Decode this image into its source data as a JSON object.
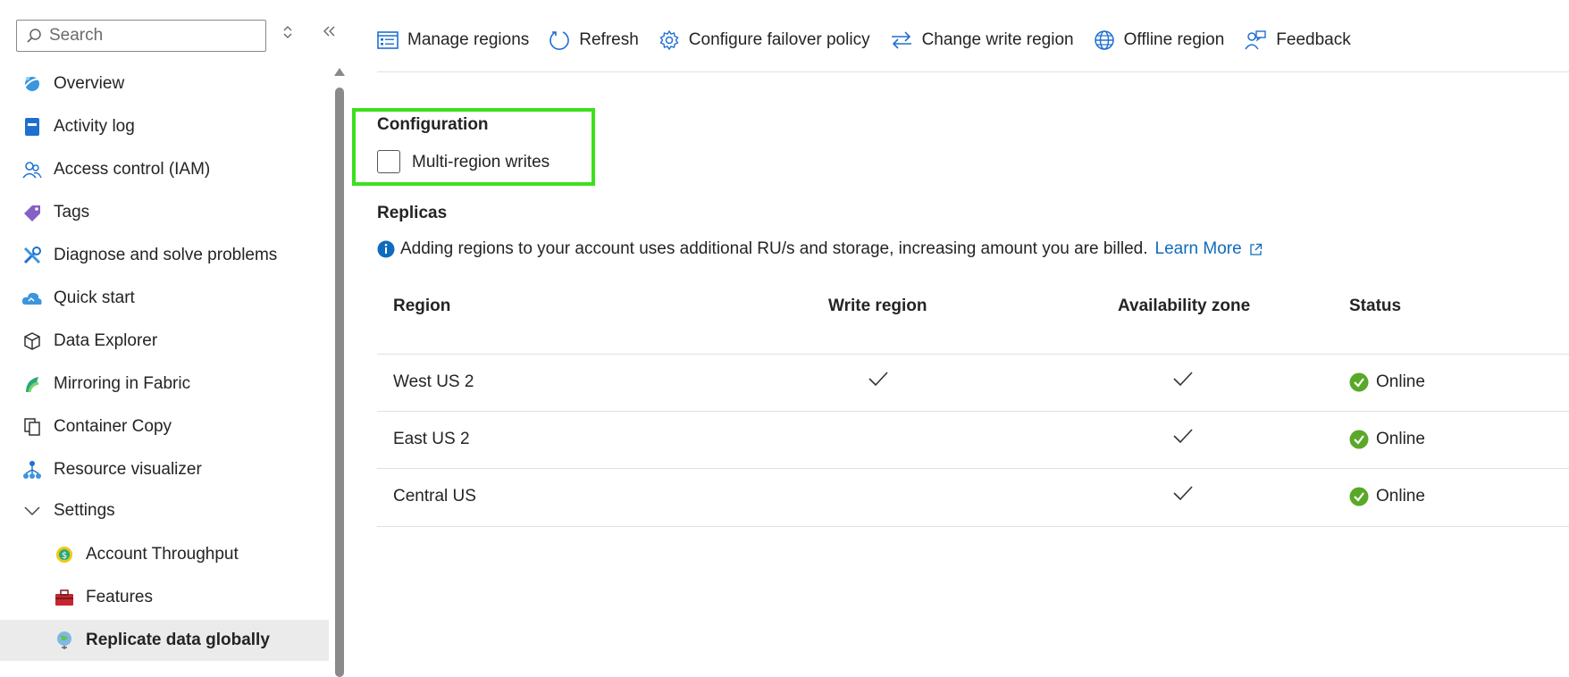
{
  "search": {
    "placeholder": "Search"
  },
  "sidebar": {
    "items": [
      {
        "label": "Overview",
        "icon": "overview-icon"
      },
      {
        "label": "Activity log",
        "icon": "activity-log-icon"
      },
      {
        "label": "Access control (IAM)",
        "icon": "people-icon"
      },
      {
        "label": "Tags",
        "icon": "tag-icon"
      },
      {
        "label": "Diagnose and solve problems",
        "icon": "wrench-icon"
      },
      {
        "label": "Quick start",
        "icon": "cloud-icon"
      },
      {
        "label": "Data Explorer",
        "icon": "cube-icon"
      },
      {
        "label": "Mirroring in Fabric",
        "icon": "fabric-icon"
      },
      {
        "label": "Container Copy",
        "icon": "copy-icon"
      },
      {
        "label": "Resource visualizer",
        "icon": "hierarchy-icon"
      },
      {
        "label": "Settings",
        "icon": "chevron-down-icon"
      },
      {
        "label": "Account Throughput",
        "icon": "throughput-icon"
      },
      {
        "label": "Features",
        "icon": "toolbox-icon"
      },
      {
        "label": "Replicate data globally",
        "icon": "globe-icon",
        "selected": true
      }
    ]
  },
  "toolbar": {
    "manage_regions": "Manage regions",
    "refresh": "Refresh",
    "configure_failover": "Configure failover policy",
    "change_write_region": "Change write region",
    "offline_region": "Offline region",
    "feedback": "Feedback"
  },
  "config": {
    "title": "Configuration",
    "multi_region_writes_label": "Multi-region writes",
    "multi_region_writes_checked": false
  },
  "replicas": {
    "title": "Replicas",
    "info_text": "Adding regions to your account uses additional RU/s and storage, increasing amount you are billed.",
    "learn_more": "Learn More"
  },
  "table": {
    "headers": {
      "region": "Region",
      "write_region": "Write region",
      "availability_zone": "Availability zone",
      "status": "Status"
    },
    "rows": [
      {
        "region": "West US 2",
        "write_region": true,
        "availability_zone": true,
        "status": "Online"
      },
      {
        "region": "East US 2",
        "write_region": false,
        "availability_zone": true,
        "status": "Online"
      },
      {
        "region": "Central US",
        "write_region": false,
        "availability_zone": true,
        "status": "Online"
      }
    ]
  },
  "colors": {
    "accent": "#0f6cbd",
    "highlight": "#3ce01c",
    "online": "#5aa828",
    "selected_bg": "#ebebeb"
  }
}
